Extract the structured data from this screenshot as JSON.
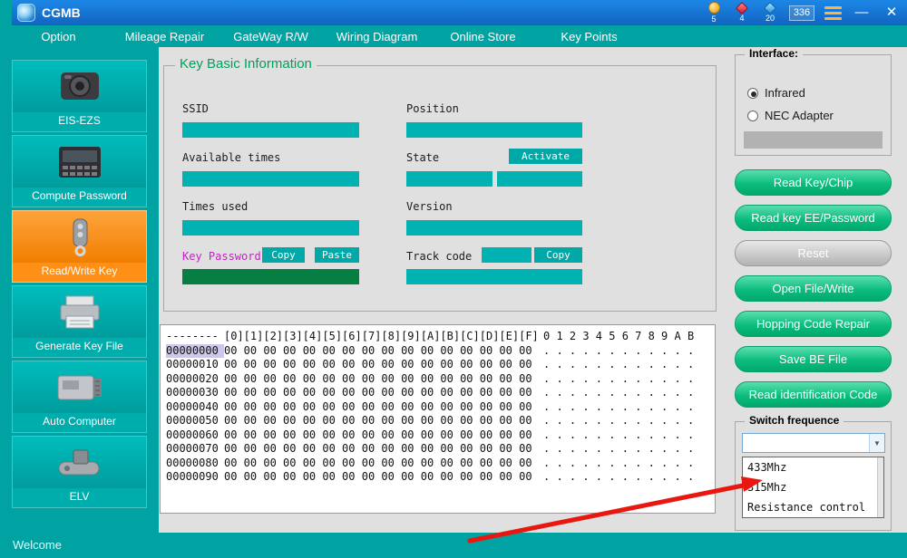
{
  "colors": {
    "accent_teal": "#00a2a2",
    "titlebar_blue": "#1373d6",
    "active_orange": "#ff9015",
    "field_teal": "#00b2b2",
    "password_field_green": "#087f42",
    "button_green": "#0cbd7e",
    "arrow_red": "#e81710"
  },
  "titlebar": {
    "title": "CGMB",
    "badges": [
      {
        "icon": "gold-coin-icon",
        "value": "5"
      },
      {
        "icon": "red-gem-icon",
        "value": "4"
      },
      {
        "icon": "blue-gem-icon",
        "value": "20"
      },
      {
        "icon": "counter-badge",
        "value": "336"
      }
    ],
    "minimize_glyph": "—",
    "close_glyph": "✕"
  },
  "menubar": {
    "items": [
      "Option",
      "Mileage Repair",
      "GateWay R/W",
      "Wiring Diagram",
      "Online Store",
      "Key Points"
    ]
  },
  "sidebar": {
    "items": [
      {
        "label": "EIS-EZS",
        "active": false
      },
      {
        "label": "Compute Password",
        "active": false
      },
      {
        "label": "Read/Write Key",
        "active": true
      },
      {
        "label": "Generate Key File",
        "active": false
      },
      {
        "label": "Auto Computer",
        "active": false
      },
      {
        "label": "ELV",
        "active": false
      }
    ],
    "status": "Welcome"
  },
  "key_info": {
    "title": "Key Basic Information",
    "labels": {
      "ssid": "SSID",
      "position": "Position",
      "available_times": "Available times",
      "state": "State",
      "times_used": "Times used",
      "version": "Version",
      "key_password": "Key Password",
      "track_code": "Track code"
    },
    "buttons": {
      "activate": "Activate",
      "copy": "Copy",
      "paste": "Paste",
      "track_copy": "Copy"
    },
    "values": {
      "ssid": "",
      "position": "",
      "available_times": "",
      "state_left": "",
      "state_right": "",
      "times_used": "",
      "version": "",
      "key_password": "",
      "track_code_inline": "",
      "track_code": ""
    }
  },
  "hex_view": {
    "header": {
      "addr": "--------",
      "cols": "[0][1][2][3][4][5][6][7][8][9][A][B][C][D][E][F]",
      "ascii": "0 1 2 3 4 5 6 7 8 9 A B"
    },
    "rows": [
      {
        "addr": "00000000",
        "bytes": "00 00 00 00 00 00 00 00 00 00 00 00 00 00 00 00",
        "ascii": ". . . . . . . . . . . ."
      },
      {
        "addr": "00000010",
        "bytes": "00 00 00 00 00 00 00 00 00 00 00 00 00 00 00 00",
        "ascii": ". . . . . . . . . . . ."
      },
      {
        "addr": "00000020",
        "bytes": "00 00 00 00 00 00 00 00 00 00 00 00 00 00 00 00",
        "ascii": ". . . . . . . . . . . ."
      },
      {
        "addr": "00000030",
        "bytes": "00 00 00 00 00 00 00 00 00 00 00 00 00 00 00 00",
        "ascii": ". . . . . . . . . . . ."
      },
      {
        "addr": "00000040",
        "bytes": "00 00 00 00 00 00 00 00 00 00 00 00 00 00 00 00",
        "ascii": ". . . . . . . . . . . ."
      },
      {
        "addr": "00000050",
        "bytes": "00 00 00 00 00 00 00 00 00 00 00 00 00 00 00 00",
        "ascii": ". . . . . . . . . . . ."
      },
      {
        "addr": "00000060",
        "bytes": "00 00 00 00 00 00 00 00 00 00 00 00 00 00 00 00",
        "ascii": ". . . . . . . . . . . ."
      },
      {
        "addr": "00000070",
        "bytes": "00 00 00 00 00 00 00 00 00 00 00 00 00 00 00 00",
        "ascii": ". . . . . . . . . . . ."
      },
      {
        "addr": "00000080",
        "bytes": "00 00 00 00 00 00 00 00 00 00 00 00 00 00 00 00",
        "ascii": ". . . . . . . . . . . ."
      },
      {
        "addr": "00000090",
        "bytes": "00 00 00 00 00 00 00 00 00 00 00 00 00 00 00 00",
        "ascii": ". . . . . . . . . . . ."
      }
    ]
  },
  "interface_panel": {
    "title": "Interface:",
    "options": [
      {
        "label": "Infrared",
        "selected": true
      },
      {
        "label": "NEC Adapter",
        "selected": false
      }
    ]
  },
  "action_buttons": [
    {
      "label": "Read Key/Chip",
      "style": "green"
    },
    {
      "label": "Read key EE/Password",
      "style": "green"
    },
    {
      "label": "Reset",
      "style": "gray"
    },
    {
      "label": "Open File/Write",
      "style": "green"
    },
    {
      "label": "Hopping Code Repair",
      "style": "green"
    },
    {
      "label": "Save BE File",
      "style": "green"
    },
    {
      "label": "Read identification Code",
      "style": "green"
    }
  ],
  "switch_frequence": {
    "title": "Switch frequence",
    "combo_value": "",
    "combo_arrow_glyph": "▼",
    "options": [
      "433Mhz",
      "315Mhz",
      "Resistance control"
    ]
  }
}
